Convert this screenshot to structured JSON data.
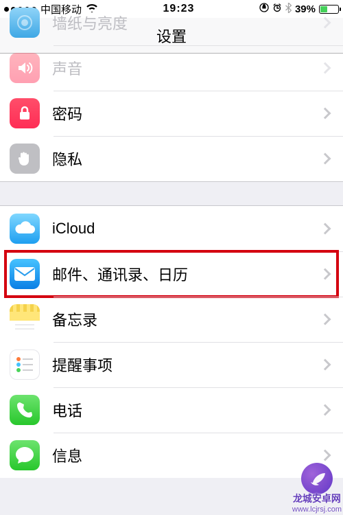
{
  "statusbar": {
    "carrier": "中国移动",
    "time": "19:23",
    "battery_pct": "39%"
  },
  "navbar": {
    "title": "设置"
  },
  "rows": {
    "wallpaper": "墙纸与亮度",
    "sound": "声音",
    "password": "密码",
    "privacy": "隐私",
    "icloud": "iCloud",
    "mail": "邮件、通讯录、日历",
    "notes": "备忘录",
    "reminders": "提醒事项",
    "phone": "电话",
    "messages": "信息"
  },
  "watermark": {
    "name": "龙城安卓网",
    "url": "www.lcjrsj.com"
  }
}
